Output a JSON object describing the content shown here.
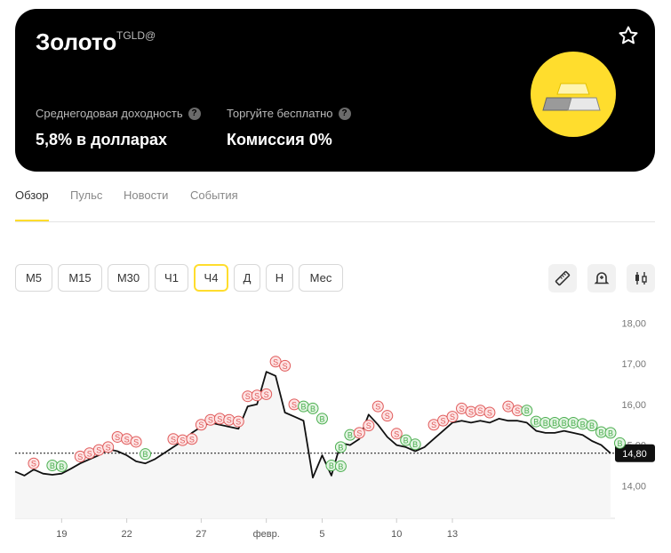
{
  "instrument": {
    "name": "Золото",
    "ticker": "TGLD@",
    "stats": [
      {
        "label": "Среднегодовая доходность",
        "value": "5,8% в долларах"
      },
      {
        "label": "Торгуйте бесплатно",
        "value": "Комиссия 0%"
      }
    ],
    "help_symbol": "?"
  },
  "tabs": [
    {
      "label": "Обзор",
      "active": true
    },
    {
      "label": "Пульс",
      "active": false
    },
    {
      "label": "Новости",
      "active": false
    },
    {
      "label": "События",
      "active": false
    }
  ],
  "timeframes": [
    {
      "label": "M5",
      "active": false
    },
    {
      "label": "M15",
      "active": false
    },
    {
      "label": "M30",
      "active": false
    },
    {
      "label": "Ч1",
      "active": false
    },
    {
      "label": "Ч4",
      "active": true
    },
    {
      "label": "Д",
      "active": false
    },
    {
      "label": "Н",
      "active": false
    },
    {
      "label": "Мес",
      "active": false
    }
  ],
  "tools": [
    "ruler-icon",
    "alert-bell-icon",
    "candles-icon"
  ],
  "colors": {
    "accent": "#ffdd2d",
    "line": "#111111",
    "sell": "#e05a5a",
    "buy": "#4caf50"
  },
  "chart_data": {
    "type": "line",
    "ylim": [
      13.2,
      18.4
    ],
    "yticks": [
      "18,00",
      "17,00",
      "16,00",
      "15,00",
      "14,00"
    ],
    "ytick_values": [
      18,
      17,
      16,
      15,
      14
    ],
    "xticks": [
      "19",
      "22",
      "27",
      "февр.",
      "5",
      "10",
      "13"
    ],
    "xtick_index": [
      5,
      12,
      20,
      27,
      33,
      41,
      47
    ],
    "last_price_label": "14,80",
    "last_price": 14.8,
    "values": [
      14.35,
      14.25,
      14.4,
      14.3,
      14.27,
      14.3,
      14.42,
      14.55,
      14.65,
      14.75,
      14.9,
      14.85,
      14.75,
      14.6,
      14.55,
      14.65,
      14.8,
      14.95,
      15.1,
      15.3,
      15.45,
      15.55,
      15.5,
      15.45,
      15.4,
      15.95,
      16.0,
      16.8,
      16.7,
      15.8,
      15.7,
      15.6,
      14.2,
      14.75,
      14.25,
      15.05,
      15.0,
      15.15,
      15.75,
      15.5,
      15.2,
      15.0,
      14.95,
      14.85,
      14.95,
      15.15,
      15.35,
      15.55,
      15.6,
      15.55,
      15.6,
      15.55,
      15.65,
      15.6,
      15.6,
      15.55,
      15.35,
      15.3,
      15.3,
      15.35,
      15.3,
      15.25,
      15.1,
      15.0,
      14.8
    ],
    "markers": [
      {
        "i": 2,
        "t": "S",
        "v": 14.55
      },
      {
        "i": 4,
        "t": "B",
        "v": 14.5
      },
      {
        "i": 5,
        "t": "B",
        "v": 14.48
      },
      {
        "i": 7,
        "t": "S",
        "v": 14.72
      },
      {
        "i": 8,
        "t": "S",
        "v": 14.8
      },
      {
        "i": 9,
        "t": "S",
        "v": 14.88
      },
      {
        "i": 10,
        "t": "S",
        "v": 14.95
      },
      {
        "i": 11,
        "t": "S",
        "v": 15.2
      },
      {
        "i": 12,
        "t": "S",
        "v": 15.15
      },
      {
        "i": 13,
        "t": "S",
        "v": 15.08
      },
      {
        "i": 14,
        "t": "B",
        "v": 14.78
      },
      {
        "i": 17,
        "t": "S",
        "v": 15.15
      },
      {
        "i": 18,
        "t": "S",
        "v": 15.12
      },
      {
        "i": 19,
        "t": "S",
        "v": 15.15
      },
      {
        "i": 20,
        "t": "S",
        "v": 15.5
      },
      {
        "i": 21,
        "t": "S",
        "v": 15.62
      },
      {
        "i": 22,
        "t": "S",
        "v": 15.65
      },
      {
        "i": 23,
        "t": "S",
        "v": 15.62
      },
      {
        "i": 24,
        "t": "S",
        "v": 15.58
      },
      {
        "i": 25,
        "t": "S",
        "v": 16.2
      },
      {
        "i": 26,
        "t": "S",
        "v": 16.22
      },
      {
        "i": 27,
        "t": "S",
        "v": 16.25
      },
      {
        "i": 28,
        "t": "S",
        "v": 17.05
      },
      {
        "i": 29,
        "t": "S",
        "v": 16.95
      },
      {
        "i": 30,
        "t": "S",
        "v": 16.0
      },
      {
        "i": 31,
        "t": "B",
        "v": 15.95
      },
      {
        "i": 32,
        "t": "B",
        "v": 15.9
      },
      {
        "i": 33,
        "t": "B",
        "v": 15.65
      },
      {
        "i": 34,
        "t": "B",
        "v": 14.5
      },
      {
        "i": 35,
        "t": "B",
        "v": 14.48
      },
      {
        "i": 35,
        "t": "B",
        "v": 14.95
      },
      {
        "i": 36,
        "t": "B",
        "v": 15.25
      },
      {
        "i": 37,
        "t": "S",
        "v": 15.3
      },
      {
        "i": 38,
        "t": "S",
        "v": 15.48
      },
      {
        "i": 39,
        "t": "S",
        "v": 15.95
      },
      {
        "i": 40,
        "t": "S",
        "v": 15.72
      },
      {
        "i": 41,
        "t": "S",
        "v": 15.28
      },
      {
        "i": 42,
        "t": "B",
        "v": 15.12
      },
      {
        "i": 43,
        "t": "B",
        "v": 15.02
      },
      {
        "i": 45,
        "t": "S",
        "v": 15.5
      },
      {
        "i": 46,
        "t": "S",
        "v": 15.6
      },
      {
        "i": 47,
        "t": "S",
        "v": 15.7
      },
      {
        "i": 48,
        "t": "S",
        "v": 15.9
      },
      {
        "i": 49,
        "t": "S",
        "v": 15.82
      },
      {
        "i": 50,
        "t": "S",
        "v": 15.85
      },
      {
        "i": 51,
        "t": "S",
        "v": 15.8
      },
      {
        "i": 53,
        "t": "S",
        "v": 15.95
      },
      {
        "i": 54,
        "t": "S",
        "v": 15.85
      },
      {
        "i": 55,
        "t": "B",
        "v": 15.85
      },
      {
        "i": 56,
        "t": "B",
        "v": 15.58
      },
      {
        "i": 57,
        "t": "B",
        "v": 15.55
      },
      {
        "i": 58,
        "t": "B",
        "v": 15.55
      },
      {
        "i": 59,
        "t": "B",
        "v": 15.55
      },
      {
        "i": 60,
        "t": "B",
        "v": 15.55
      },
      {
        "i": 61,
        "t": "B",
        "v": 15.52
      },
      {
        "i": 62,
        "t": "B",
        "v": 15.48
      },
      {
        "i": 63,
        "t": "B",
        "v": 15.32
      },
      {
        "i": 64,
        "t": "B",
        "v": 15.3
      },
      {
        "i": 65,
        "t": "B",
        "v": 15.05
      }
    ]
  }
}
